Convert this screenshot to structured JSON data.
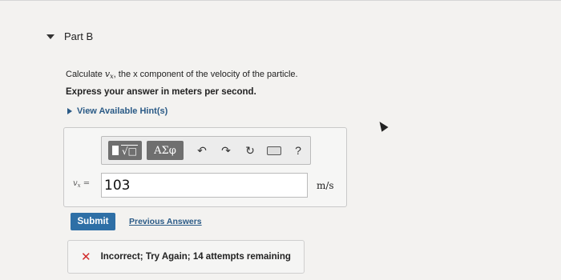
{
  "part": {
    "title": "Part B"
  },
  "question": {
    "prefix": "Calculate ",
    "var_symbol": "v",
    "var_sub": "x",
    "suffix": ", the x component of the velocity of the particle.",
    "instruction": "Express your answer in meters per second."
  },
  "hint": {
    "label": "View Available Hint(s)"
  },
  "toolbar": {
    "templates_radical": "√□",
    "greek_label": "ΑΣφ",
    "undo_glyph": "↶",
    "redo_glyph": "↷",
    "reset_glyph": "↻",
    "help_label": "?"
  },
  "answer": {
    "var_symbol": "v",
    "var_sub": "x",
    "equals": " =",
    "value": "103",
    "unit": "m/s"
  },
  "actions": {
    "submit_label": "Submit",
    "previous_answers_label": "Previous Answers"
  },
  "feedback": {
    "icon": "✕",
    "text": "Incorrect; Try Again; 14 attempts remaining"
  },
  "colors": {
    "submit": "#2e6fa6",
    "link": "#2a5a86",
    "error": "#d12b2b"
  }
}
